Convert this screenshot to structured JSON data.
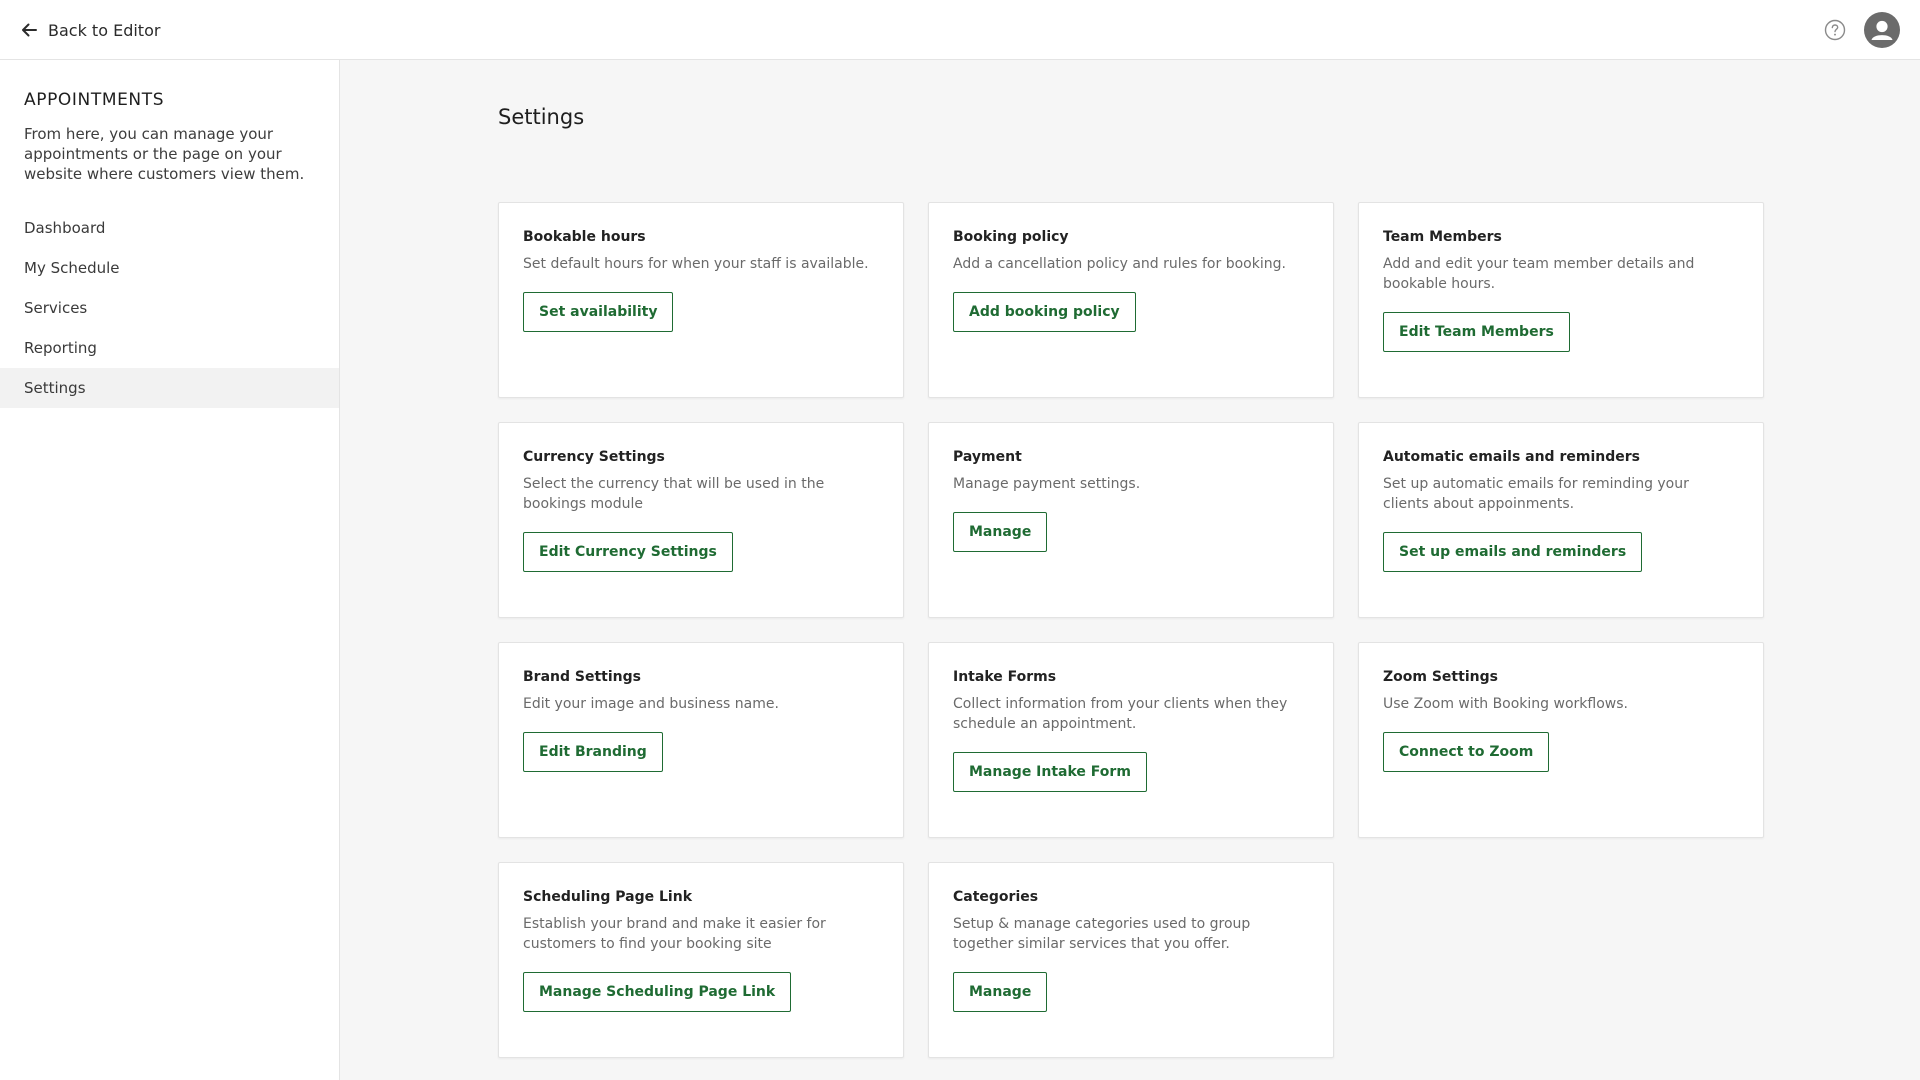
{
  "header": {
    "back_label": "Back to Editor",
    "back_icon": "arrow-left-icon",
    "help_icon": "help-circle-icon",
    "avatar_icon": "user-avatar-icon"
  },
  "sidebar": {
    "title": "APPOINTMENTS",
    "description": "From here, you can manage your appointments or the page on your website where customers view them.",
    "items": [
      {
        "label": "Dashboard",
        "active": false
      },
      {
        "label": "My Schedule",
        "active": false
      },
      {
        "label": "Services",
        "active": false
      },
      {
        "label": "Reporting",
        "active": false
      },
      {
        "label": "Settings",
        "active": true
      }
    ]
  },
  "main": {
    "title": "Settings",
    "cards": [
      {
        "title": "Bookable hours",
        "description": "Set default hours for when your staff is available.",
        "button": "Set availability"
      },
      {
        "title": "Booking policy",
        "description": "Add a cancellation policy and rules for booking.",
        "button": "Add booking policy"
      },
      {
        "title": "Team Members",
        "description": "Add and edit your team member details and bookable hours.",
        "button": "Edit Team Members"
      },
      {
        "title": "Currency Settings",
        "description": "Select the currency that will be used in the bookings module",
        "button": "Edit Currency Settings"
      },
      {
        "title": "Payment",
        "description": "Manage payment settings.",
        "button": "Manage"
      },
      {
        "title": "Automatic emails and reminders",
        "description": "Set up automatic emails for reminding your clients about appoinments.",
        "button": "Set up emails and reminders"
      },
      {
        "title": "Brand Settings",
        "description": "Edit your image and business name.",
        "button": "Edit Branding"
      },
      {
        "title": "Intake Forms",
        "description": "Collect information from your clients when they schedule an appointment.",
        "button": "Manage Intake Form"
      },
      {
        "title": "Zoom Settings",
        "description": "Use Zoom with Booking workflows.",
        "button": "Connect to Zoom"
      },
      {
        "title": "Scheduling Page Link",
        "description": "Establish your brand and make it easier for customers to find your booking site",
        "button": "Manage Scheduling Page Link"
      },
      {
        "title": "Categories",
        "description": "Setup & manage categories used to group together similar services that you offer.",
        "button": "Manage"
      }
    ]
  },
  "colors": {
    "accent": "#1f6b33",
    "main_background": "#f6f6f6",
    "sidebar_active": "#f2f2f2"
  }
}
